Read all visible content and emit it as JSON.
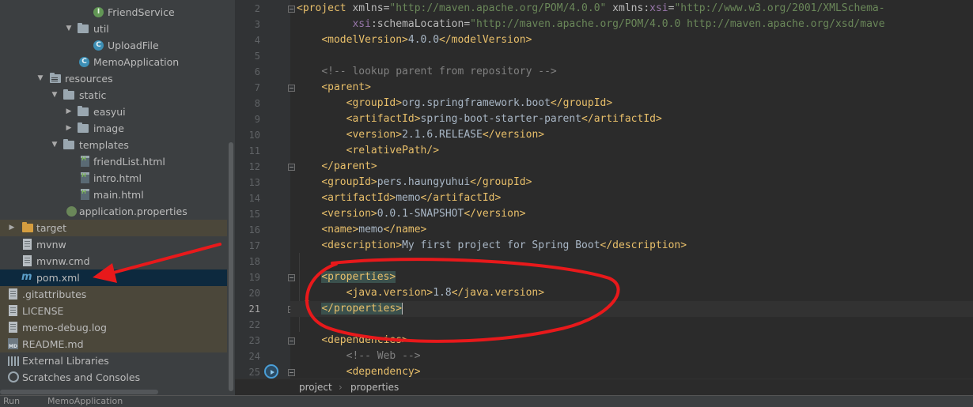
{
  "project_tree": {
    "items": [
      {
        "label": "FriendService",
        "icon": "interface-icon"
      },
      {
        "label": "util",
        "icon": "folder-icon"
      },
      {
        "label": "UploadFile",
        "icon": "class-icon"
      },
      {
        "label": "MemoApplication",
        "icon": "spring-class-icon"
      },
      {
        "label": "resources",
        "icon": "resources-folder-icon"
      },
      {
        "label": "static",
        "icon": "folder-icon"
      },
      {
        "label": "easyui",
        "icon": "folder-icon"
      },
      {
        "label": "image",
        "icon": "folder-icon"
      },
      {
        "label": "templates",
        "icon": "folder-icon"
      },
      {
        "label": "friendList.html",
        "icon": "html-file-icon"
      },
      {
        "label": "intro.html",
        "icon": "html-file-icon"
      },
      {
        "label": "main.html",
        "icon": "html-file-icon"
      },
      {
        "label": "application.properties",
        "icon": "properties-file-icon"
      },
      {
        "label": "target",
        "icon": "folder-icon"
      },
      {
        "label": "mvnw",
        "icon": "file-icon"
      },
      {
        "label": "mvnw.cmd",
        "icon": "file-icon"
      },
      {
        "label": "pom.xml",
        "icon": "maven-icon"
      },
      {
        "label": ".gitattributes",
        "icon": "file-icon"
      },
      {
        "label": "LICENSE",
        "icon": "file-icon"
      },
      {
        "label": "memo-debug.log",
        "icon": "file-icon"
      },
      {
        "label": "README.md",
        "icon": "markdown-icon"
      },
      {
        "label": "External Libraries",
        "icon": "libraries-icon"
      },
      {
        "label": "Scratches and Consoles",
        "icon": "scratches-icon"
      }
    ]
  },
  "editor": {
    "lines": [
      {
        "n": "2",
        "parts": [
          [
            "<project ",
            "t"
          ],
          [
            "xmlns=",
            "a"
          ],
          [
            "\"http://maven.apache.org/POM/4.0.0\"",
            "v"
          ],
          [
            " xmlns:",
            "a"
          ],
          [
            "xsi",
            "ns"
          ],
          [
            "=",
            "a"
          ],
          [
            "\"http://www.w3.org/2001/XMLSchema-",
            "v"
          ]
        ]
      },
      {
        "n": "3",
        "parts": [
          [
            "         ",
            "a"
          ],
          [
            "xsi",
            "ns"
          ],
          [
            ":schemaLocation=",
            "a"
          ],
          [
            "\"http://maven.apache.org/POM/4.0.0 http://maven.apache.org/xsd/mave",
            "v"
          ]
        ]
      },
      {
        "n": "4",
        "parts": [
          [
            "    ",
            "a"
          ],
          [
            "<modelVersion>",
            "t"
          ],
          [
            "4.0.0",
            "x"
          ],
          [
            "</modelVersion>",
            "t"
          ]
        ]
      },
      {
        "n": "5",
        "parts": []
      },
      {
        "n": "6",
        "parts": [
          [
            "    ",
            "a"
          ],
          [
            "<!-- lookup parent from repository -->",
            "c"
          ]
        ]
      },
      {
        "n": "7",
        "parts": [
          [
            "    ",
            "a"
          ],
          [
            "<parent>",
            "t"
          ]
        ]
      },
      {
        "n": "8",
        "parts": [
          [
            "        ",
            "a"
          ],
          [
            "<groupId>",
            "t"
          ],
          [
            "org.springframework.boot",
            "x"
          ],
          [
            "</groupId>",
            "t"
          ]
        ]
      },
      {
        "n": "9",
        "parts": [
          [
            "        ",
            "a"
          ],
          [
            "<artifactId>",
            "t"
          ],
          [
            "spring-boot-starter-parent",
            "x"
          ],
          [
            "</artifactId>",
            "t"
          ]
        ]
      },
      {
        "n": "10",
        "parts": [
          [
            "        ",
            "a"
          ],
          [
            "<version>",
            "t"
          ],
          [
            "2.1.6.RELEASE",
            "x"
          ],
          [
            "</version>",
            "t"
          ]
        ]
      },
      {
        "n": "11",
        "parts": [
          [
            "        ",
            "a"
          ],
          [
            "<relativePath/>",
            "t"
          ]
        ]
      },
      {
        "n": "12",
        "parts": [
          [
            "    ",
            "a"
          ],
          [
            "</parent>",
            "t"
          ]
        ]
      },
      {
        "n": "13",
        "parts": [
          [
            "    ",
            "a"
          ],
          [
            "<groupId>",
            "t"
          ],
          [
            "pers.haungyuhui",
            "x"
          ],
          [
            "</groupId>",
            "t"
          ]
        ]
      },
      {
        "n": "14",
        "parts": [
          [
            "    ",
            "a"
          ],
          [
            "<artifactId>",
            "t"
          ],
          [
            "memo",
            "x"
          ],
          [
            "</artifactId>",
            "t"
          ]
        ]
      },
      {
        "n": "15",
        "parts": [
          [
            "    ",
            "a"
          ],
          [
            "<version>",
            "t"
          ],
          [
            "0.0.1-SNAPSHOT",
            "x"
          ],
          [
            "</version>",
            "t"
          ]
        ]
      },
      {
        "n": "16",
        "parts": [
          [
            "    ",
            "a"
          ],
          [
            "<name>",
            "t"
          ],
          [
            "memo",
            "x"
          ],
          [
            "</name>",
            "t"
          ]
        ]
      },
      {
        "n": "17",
        "parts": [
          [
            "    ",
            "a"
          ],
          [
            "<description>",
            "t"
          ],
          [
            "My first project for Spring Boot",
            "x"
          ],
          [
            "</description>",
            "t"
          ]
        ]
      },
      {
        "n": "18",
        "parts": []
      },
      {
        "n": "19",
        "parts": [
          [
            "    ",
            "a"
          ],
          [
            "<properties>",
            "th"
          ]
        ]
      },
      {
        "n": "20",
        "parts": [
          [
            "        ",
            "a"
          ],
          [
            "<java.version>",
            "t"
          ],
          [
            "1.8",
            "x"
          ],
          [
            "</java.version>",
            "t"
          ]
        ]
      },
      {
        "n": "21",
        "parts": [
          [
            "    ",
            "a"
          ],
          [
            "</properties>",
            "th"
          ]
        ]
      },
      {
        "n": "22",
        "parts": []
      },
      {
        "n": "23",
        "parts": [
          [
            "    ",
            "a"
          ],
          [
            "<dependencies>",
            "t"
          ]
        ]
      },
      {
        "n": "24",
        "parts": [
          [
            "        ",
            "a"
          ],
          [
            "<!-- Web -->",
            "c"
          ]
        ]
      },
      {
        "n": "25",
        "parts": [
          [
            "        ",
            "a"
          ],
          [
            "<dependency>",
            "t"
          ]
        ]
      }
    ]
  },
  "breadcrumb": {
    "items": [
      "project",
      "properties"
    ],
    "separator": "›"
  },
  "status_strip": {
    "left": "Run",
    "tab": "MemoApplication"
  },
  "colors": {
    "tag": "#e8bf6a",
    "string": "#6a8759",
    "comment": "#808080",
    "text": "#a9b7c6",
    "annotation_red": "#e8191b"
  }
}
